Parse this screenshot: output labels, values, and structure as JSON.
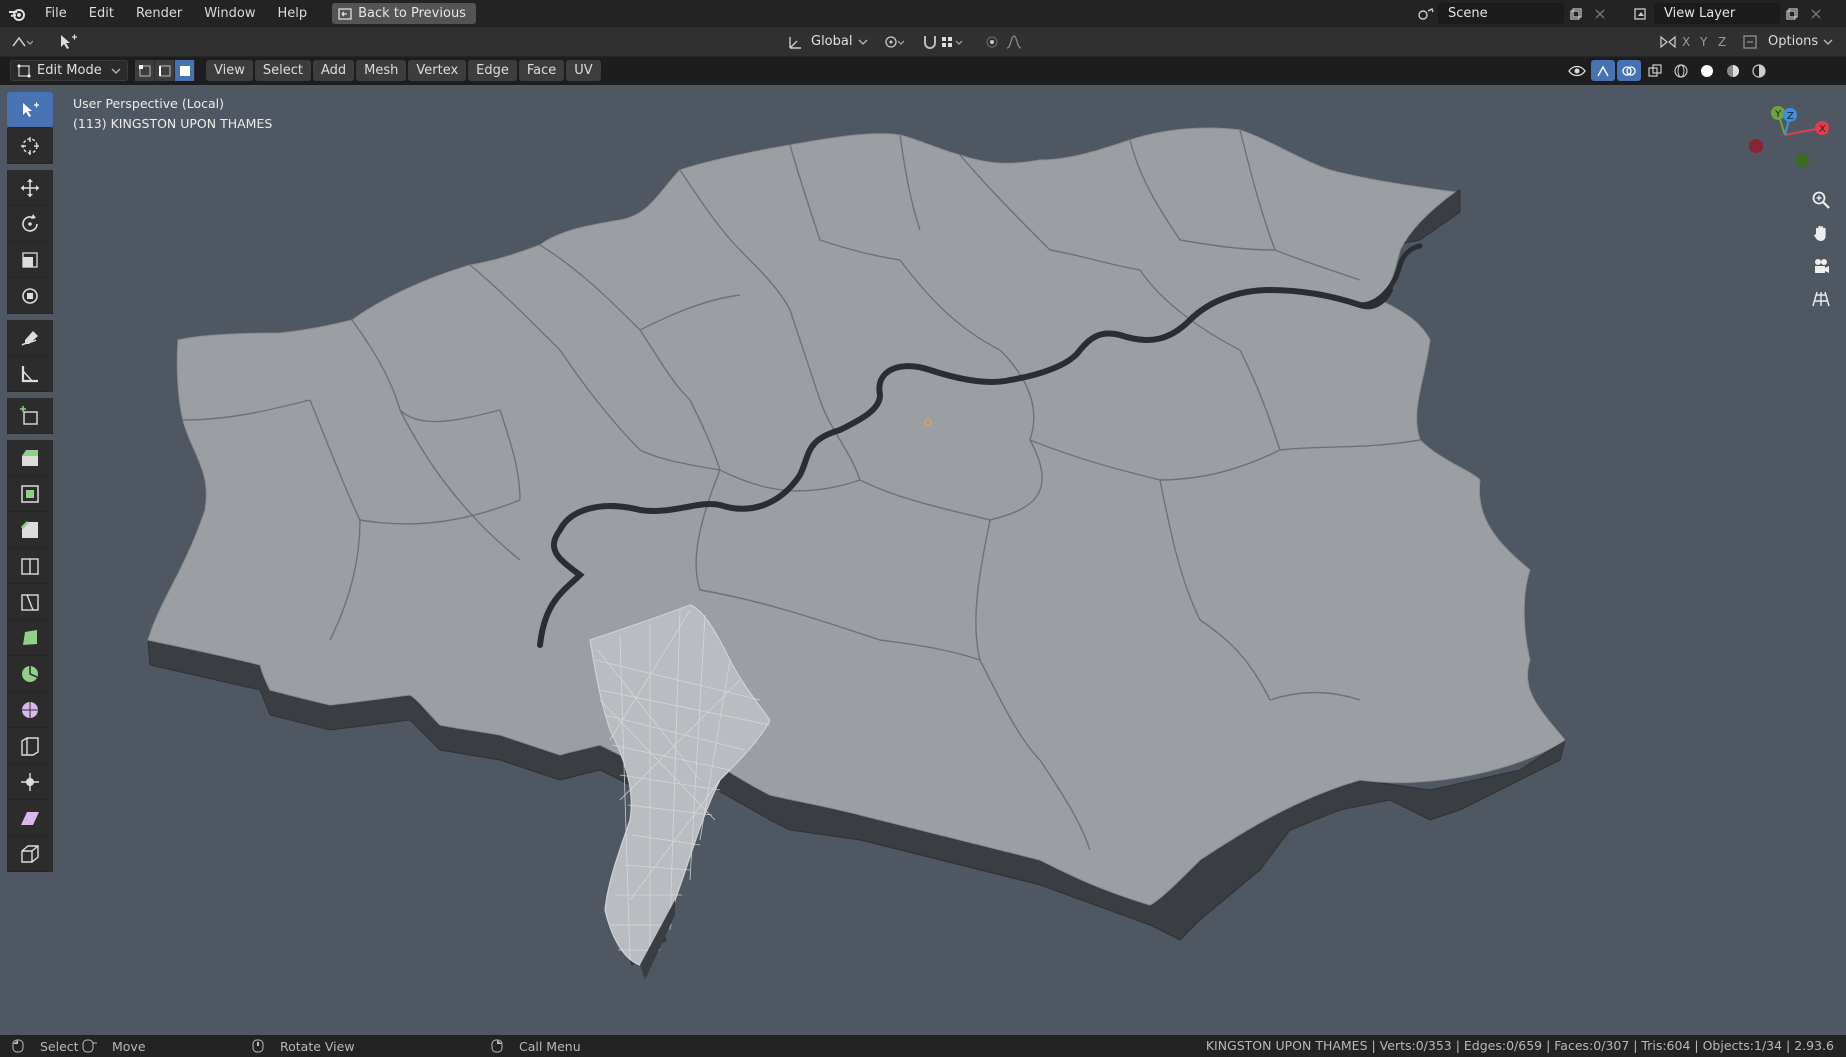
{
  "topbar": {
    "menus": [
      "File",
      "Edit",
      "Render",
      "Window",
      "Help"
    ],
    "back_button": "Back to Previous",
    "scene_label": "Scene",
    "view_layer_label": "View Layer"
  },
  "header": {
    "transform_orientation": "Global",
    "axes": [
      "X",
      "Y",
      "Z"
    ],
    "options_label": "Options"
  },
  "edit_header": {
    "mode": "Edit Mode",
    "menus": [
      "View",
      "Select",
      "Add",
      "Mesh",
      "Vertex",
      "Edge",
      "Face",
      "UV"
    ]
  },
  "viewport": {
    "perspective_label": "User Perspective (Local)",
    "object_label": "(113) KINGSTON UPON THAMES",
    "gizmo_axes": [
      "X",
      "Y",
      "Z"
    ]
  },
  "tools": [
    "select-box",
    "cursor",
    "move",
    "rotate",
    "scale",
    "transform",
    "annotate",
    "measure",
    "add-cube",
    "extrude",
    "inset",
    "bevel",
    "loop-cut",
    "knife",
    "poly-build",
    "spin",
    "smooth",
    "edge-slide",
    "shrink-fatten",
    "shear",
    "rip-region"
  ],
  "statusbar": {
    "select_label": "Select",
    "move_label": "Move",
    "rotate_label": "Rotate View",
    "menu_label": "Call Menu",
    "stats": "KINGSTON UPON THAMES | Verts:0/353 | Edges:0/659 | Faces:0/307 | Tris:604 | Objects:1/34 | 2.93.6"
  },
  "colors": {
    "accent": "#4772b3",
    "viewport_bg": "#4f5862",
    "map_top": "#9b9ea2",
    "map_side": "#3e4246",
    "river": "#2a2e33",
    "axis_x": "#e03d4f",
    "axis_y": "#6fa43a",
    "axis_z": "#3f8fe0"
  }
}
